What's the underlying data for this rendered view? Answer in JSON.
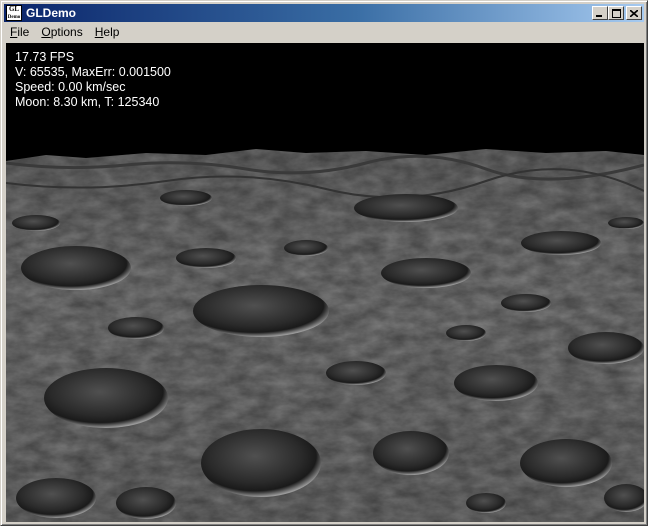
{
  "window": {
    "title": "GLDemo",
    "icon_text": "GL\nDemo"
  },
  "menu": {
    "items": [
      {
        "prefix": "",
        "accel": "F",
        "rest": "ile"
      },
      {
        "prefix": "",
        "accel": "O",
        "rest": "ptions"
      },
      {
        "prefix": "",
        "accel": "H",
        "rest": "elp"
      }
    ]
  },
  "hud": {
    "fps": "17.73 FPS",
    "vertices": "V: 65535, MaxErr: 0.001500",
    "speed": "Speed: 0.00 km/sec",
    "moon": "Moon: 8.30 km, T: 125340"
  },
  "colors": {
    "sky": "#000000",
    "terrain_light": "#8a8a8a",
    "terrain_mid": "#5e5e5e",
    "terrain_dark": "#1e1e1e",
    "titlebar_start": "#0a246a",
    "titlebar_end": "#a6caf0"
  },
  "icons": [
    "minimize-icon",
    "maximize-icon",
    "close-icon",
    "app-icon"
  ]
}
